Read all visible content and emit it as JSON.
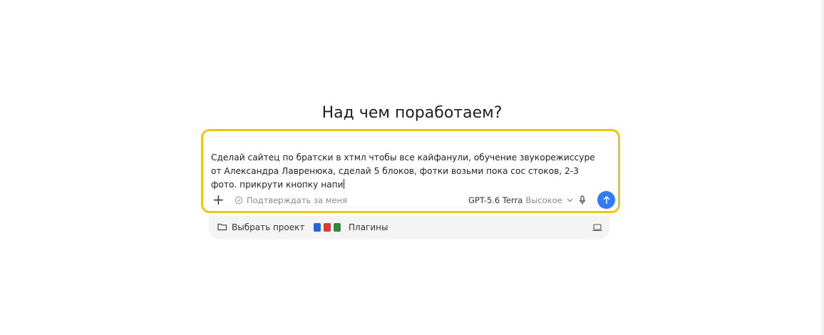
{
  "heading": "Над чем поработаем?",
  "composer": {
    "text": "Сделай сайтец по братски в хтмл чтобы все кайфанули, обучение звукорежиссуре от Александра Лавренюка, сделай 5 блоков, фотки возьми пока сос стоков, 2-3 фото. прикрути кнопку напи",
    "confirm_label": "Подтверждать за меня",
    "model_name": "GPT-5.6 Terra",
    "model_level": "Высокое",
    "highlight_color": "#f1c40f",
    "send_color": "#2f7cf6"
  },
  "bottom": {
    "project_label": "Выбрать проект",
    "plugins_label": "Плагины"
  }
}
